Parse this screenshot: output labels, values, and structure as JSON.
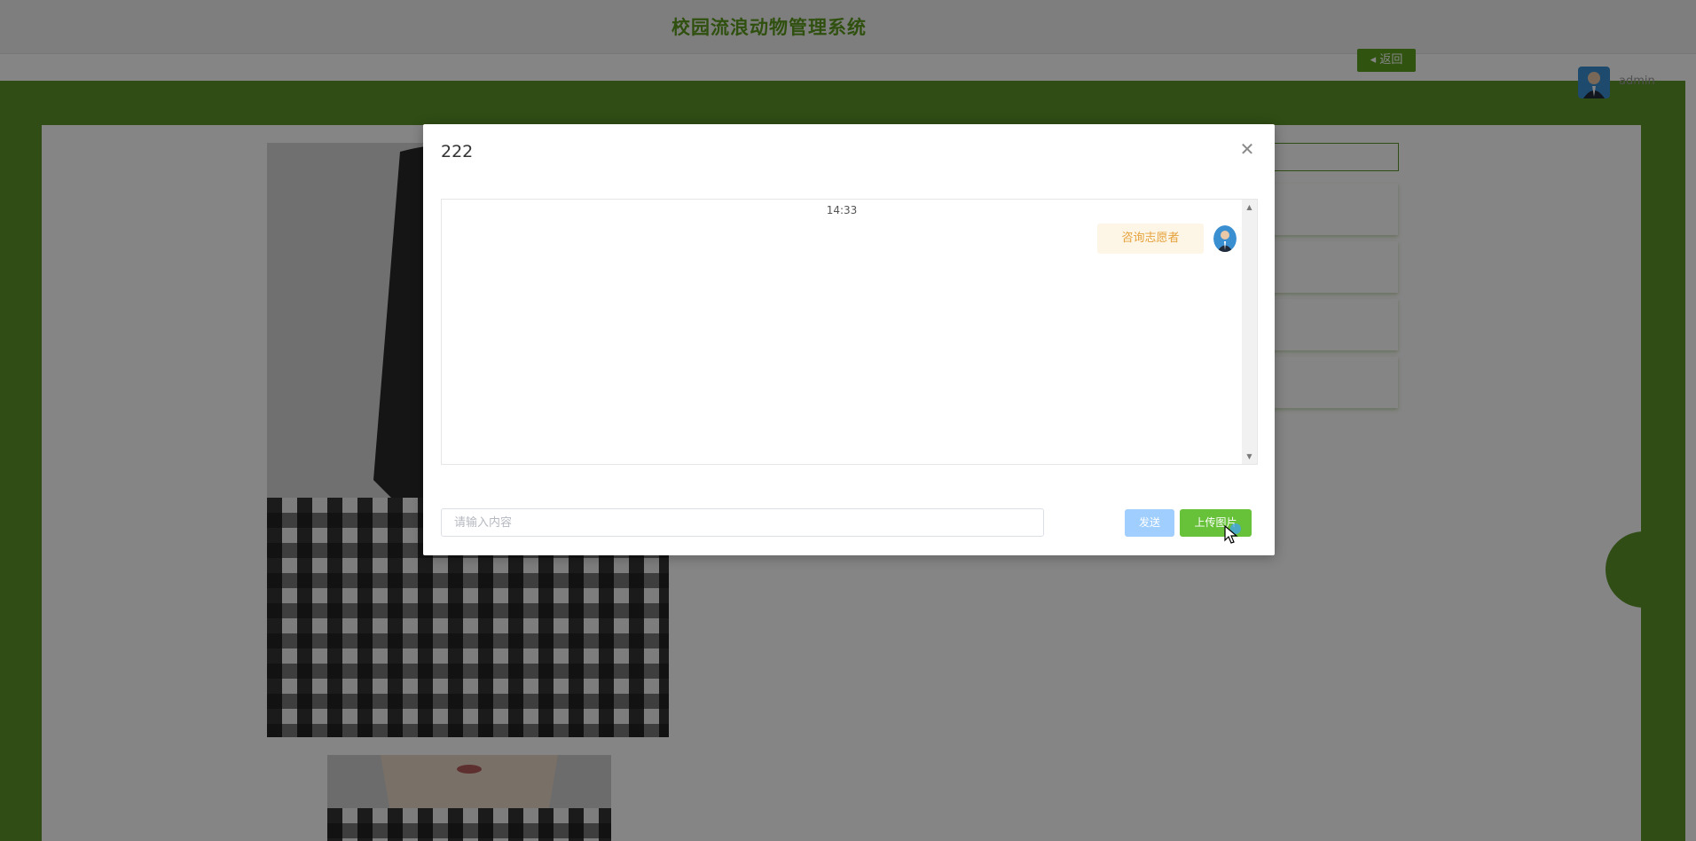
{
  "header": {
    "site_title": "校园流浪动物管理系统",
    "back_label": "◂ 返回",
    "user_name": "admin"
  },
  "modal": {
    "title": "222",
    "close_icon": "close-icon",
    "chat": {
      "time": "14:33",
      "messages": [
        {
          "text": "咨询志愿者",
          "side": "right"
        }
      ]
    },
    "input_placeholder": "请输入内容",
    "input_value": "",
    "send_label": "发送",
    "upload_label": "上传图片"
  },
  "colors": {
    "brand_green": "#5d9429",
    "title_green": "#5a9a1c",
    "send_disabled": "#a0cfff",
    "upload_green": "#67c23a",
    "bubble_bg": "#fdf6e6",
    "bubble_text": "#e6a23c"
  }
}
